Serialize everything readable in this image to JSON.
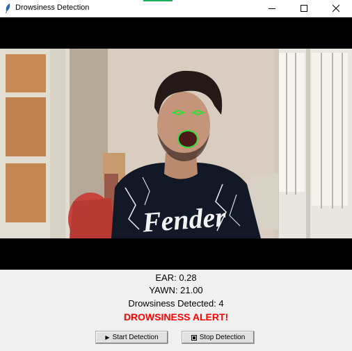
{
  "window": {
    "title": "Drowsiness Detection",
    "icon": "feather-icon",
    "controls": [
      "minimize-icon",
      "maximize-icon",
      "close-icon"
    ]
  },
  "video_feed": {
    "description_icon": "camera-feed",
    "landmark_color": "#33dd33"
  },
  "stats": {
    "ear": "EAR: 0.28",
    "yawn": "YAWN: 21.00",
    "drowsiness_count": "Drowsiness Detected: 4"
  },
  "alert": {
    "text": "DROWSINESS ALERT!",
    "color": "#ff0000"
  },
  "buttons": {
    "start_label": "Start Detection",
    "stop_label": "Stop Detection"
  },
  "colors": {
    "background": "#f0f0f0",
    "titlebar_accent": "#1aae5b"
  }
}
